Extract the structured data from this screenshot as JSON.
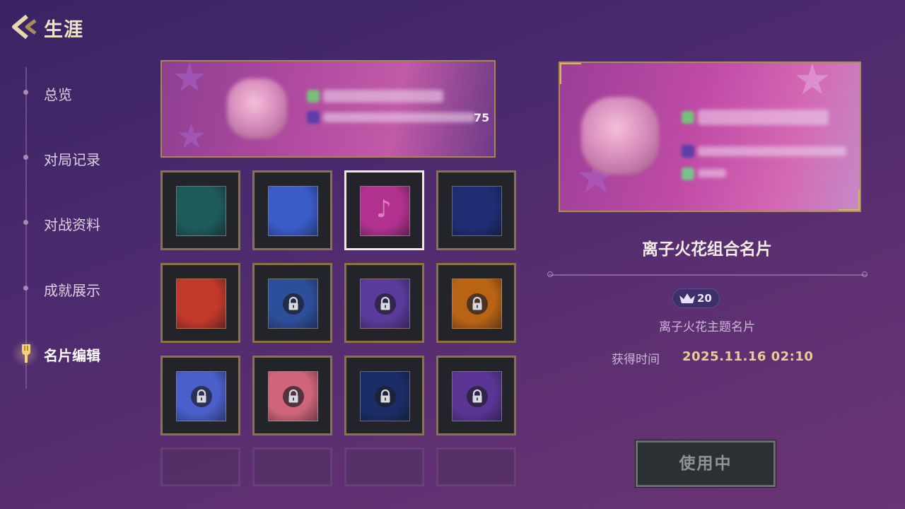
{
  "header": {
    "title": "生涯",
    "back_icon": "back-arrow-icon"
  },
  "sidebar": {
    "items": [
      {
        "label": "总览",
        "active": false
      },
      {
        "label": "对局记录",
        "active": false
      },
      {
        "label": "对战资料",
        "active": false
      },
      {
        "label": "成就展示",
        "active": false
      },
      {
        "label": "名片编辑",
        "active": true,
        "icon": "spatula-icon"
      }
    ]
  },
  "banner": {
    "value_suffix": "75"
  },
  "grid": {
    "tiles": [
      {
        "name": "teal",
        "locked": false,
        "selected": false,
        "color": "#1f5a5a"
      },
      {
        "name": "cosmic-blue",
        "locked": false,
        "selected": false,
        "color": "#3a5cc9"
      },
      {
        "name": "pink-music",
        "locked": false,
        "selected": true,
        "color": "#b0328e"
      },
      {
        "name": "navy",
        "locked": false,
        "selected": false,
        "color": "#1f2d73"
      },
      {
        "name": "red-orange",
        "locked": false,
        "selected": false,
        "color": "#c0392b"
      },
      {
        "name": "blue-ornate",
        "locked": true,
        "selected": false,
        "color": "#2d4e9a"
      },
      {
        "name": "purple-ornate",
        "locked": true,
        "selected": false,
        "color": "#5a3a9a"
      },
      {
        "name": "amber",
        "locked": true,
        "selected": false,
        "color": "#b86414"
      },
      {
        "name": "blue-dragon",
        "locked": true,
        "selected": false,
        "color": "#4a5fc9"
      },
      {
        "name": "peach-fox",
        "locked": true,
        "selected": false,
        "color": "#d0657a"
      },
      {
        "name": "dark-blue-dragon",
        "locked": true,
        "selected": false,
        "color": "#1b2d66"
      },
      {
        "name": "violet-galaxy",
        "locked": true,
        "selected": false,
        "color": "#5a3596"
      }
    ]
  },
  "detail": {
    "name": "离子火花组合名片",
    "badge_value": "20",
    "subtitle": "离子火花主题名片",
    "date_label": "获得时间",
    "date_value": "2025.11.16  02:10",
    "use_button": "使用中"
  },
  "colors": {
    "accent_gold": "#c8a25a",
    "bg_purple": "#4a2a6e"
  }
}
